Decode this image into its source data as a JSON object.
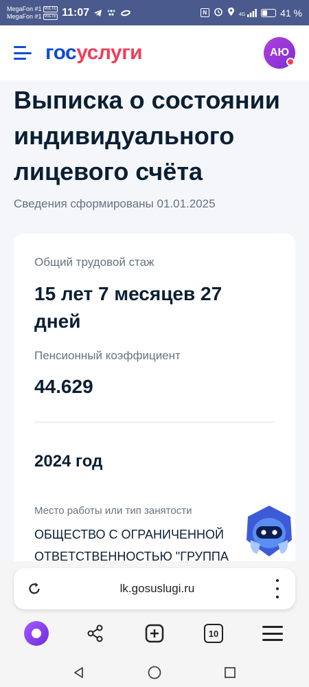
{
  "status_bar": {
    "carrier1": "MegaFon #1",
    "carrier2": "MegaFon #1",
    "volte": "VoLTE",
    "time": "11:07",
    "nfc": "N",
    "network": "4G",
    "battery_percent": "41 %",
    "battery_level": 0.41
  },
  "header": {
    "logo_part1": "гос",
    "logo_part2": "услуги",
    "avatar_initials": "АЮ",
    "colors": {
      "brand_blue": "#0d4cd3",
      "brand_red": "#ee3f58"
    }
  },
  "page": {
    "title": "Выписка о состоянии индивидуального лицевого счёта",
    "subtitle": "Сведения сформированы 01.01.2025"
  },
  "card": {
    "experience_label": "Общий трудовой стаж",
    "experience_value": "15 лет 7 месяцев 27 дней",
    "coefficient_label": "Пенсионный коэффициент",
    "coefficient_value": "44.629",
    "year": "2024 год",
    "employment_label": "Место работы или тип занятости",
    "employment_value": "ОБЩЕСТВО С ОГРАНИЧЕННОЙ ОТВЕТСТВЕННОСТЬЮ \"ГРУППА"
  },
  "browser": {
    "url": "lk.gosuslugi.ru",
    "tabs_count": "10",
    "icons": [
      "refresh-icon",
      "menu-dots-icon",
      "alice-icon",
      "share-icon",
      "new-tab-icon",
      "tabs-icon",
      "hamburger-icon"
    ]
  },
  "android_nav": {
    "icons": [
      "back-icon",
      "home-icon",
      "recents-icon"
    ]
  }
}
